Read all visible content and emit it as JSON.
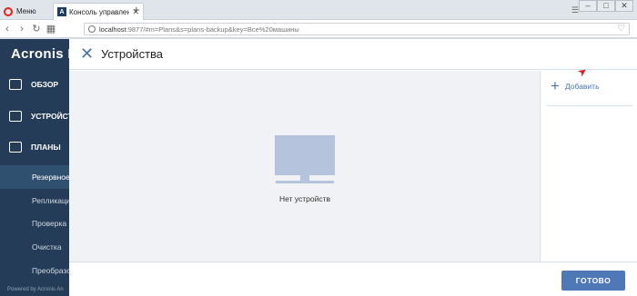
{
  "browser": {
    "menu_label": "Меню",
    "tab_title": "Консоль управления резер",
    "url_host": "localhost",
    "url_rest": ":9877/#m=Plans&s=plans-backup&key=Все%20машины"
  },
  "sidebar": {
    "logo": "Acronis B",
    "items": [
      {
        "label": "ОБЗОР",
        "icon": "dashboard-icon"
      },
      {
        "label": "УСТРОЙСТВ",
        "icon": "monitor-icon"
      },
      {
        "label": "ПЛАНЫ",
        "icon": "plans-icon"
      }
    ],
    "subitems": [
      {
        "label": "Резервное"
      },
      {
        "label": "Репликаци"
      },
      {
        "label": "Проверка"
      },
      {
        "label": "Очистка"
      },
      {
        "label": "Преобразо"
      }
    ],
    "powered": "Powered by Acronis An"
  },
  "dialog": {
    "title": "Устройства",
    "empty_text": "Нет устройств",
    "add_label": "Добавить",
    "done_label": "ГОТОВО"
  },
  "colors": {
    "sidebar_bg": "#243c57",
    "accent": "#4e79b6",
    "arrow": "#e02020"
  }
}
